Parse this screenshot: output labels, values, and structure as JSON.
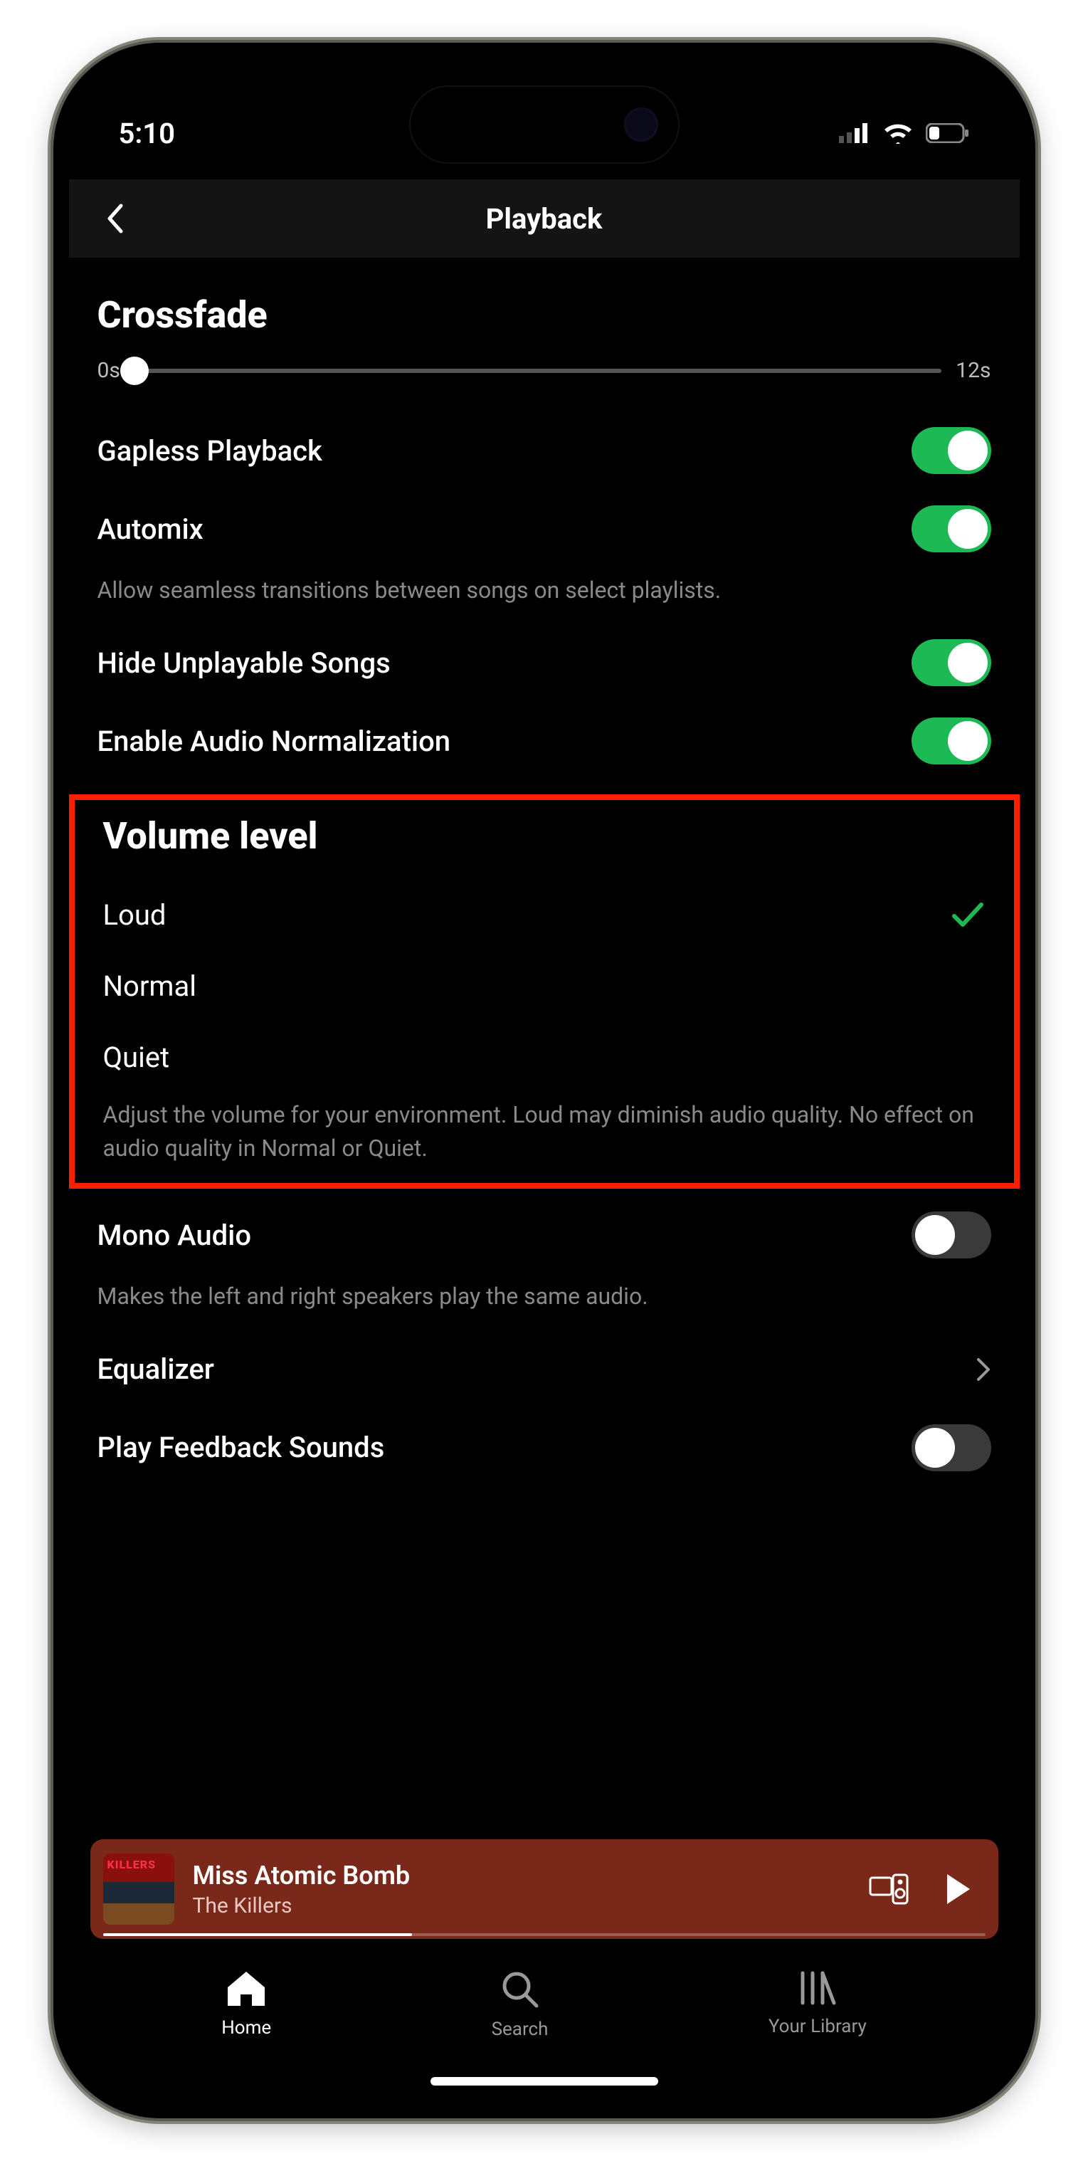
{
  "status": {
    "time": "5:10"
  },
  "header": {
    "title": "Playback"
  },
  "crossfade": {
    "title": "Crossfade",
    "min_label": "0s",
    "max_label": "12s"
  },
  "settings": {
    "gapless": {
      "label": "Gapless Playback",
      "on": true
    },
    "automix": {
      "label": "Automix",
      "on": true,
      "desc": "Allow seamless transitions between songs on select playlists."
    },
    "hide_unplayable": {
      "label": "Hide Unplayable Songs",
      "on": true
    },
    "normalization": {
      "label": "Enable Audio Normalization",
      "on": true
    },
    "mono": {
      "label": "Mono Audio",
      "on": false,
      "desc": "Makes the left and right speakers play the same audio."
    },
    "equalizer": {
      "label": "Equalizer"
    },
    "feedback": {
      "label": "Play Feedback Sounds",
      "on": false
    }
  },
  "volume": {
    "title": "Volume level",
    "options": {
      "loud": "Loud",
      "normal": "Normal",
      "quiet": "Quiet"
    },
    "selected": "loud",
    "desc": "Adjust the volume for your environment. Loud may diminish audio quality. No effect on audio quality in Normal or Quiet."
  },
  "now_playing": {
    "title": "Miss Atomic Bomb",
    "artist": "The Killers"
  },
  "tabs": {
    "home": "Home",
    "search": "Search",
    "library": "Your Library"
  }
}
